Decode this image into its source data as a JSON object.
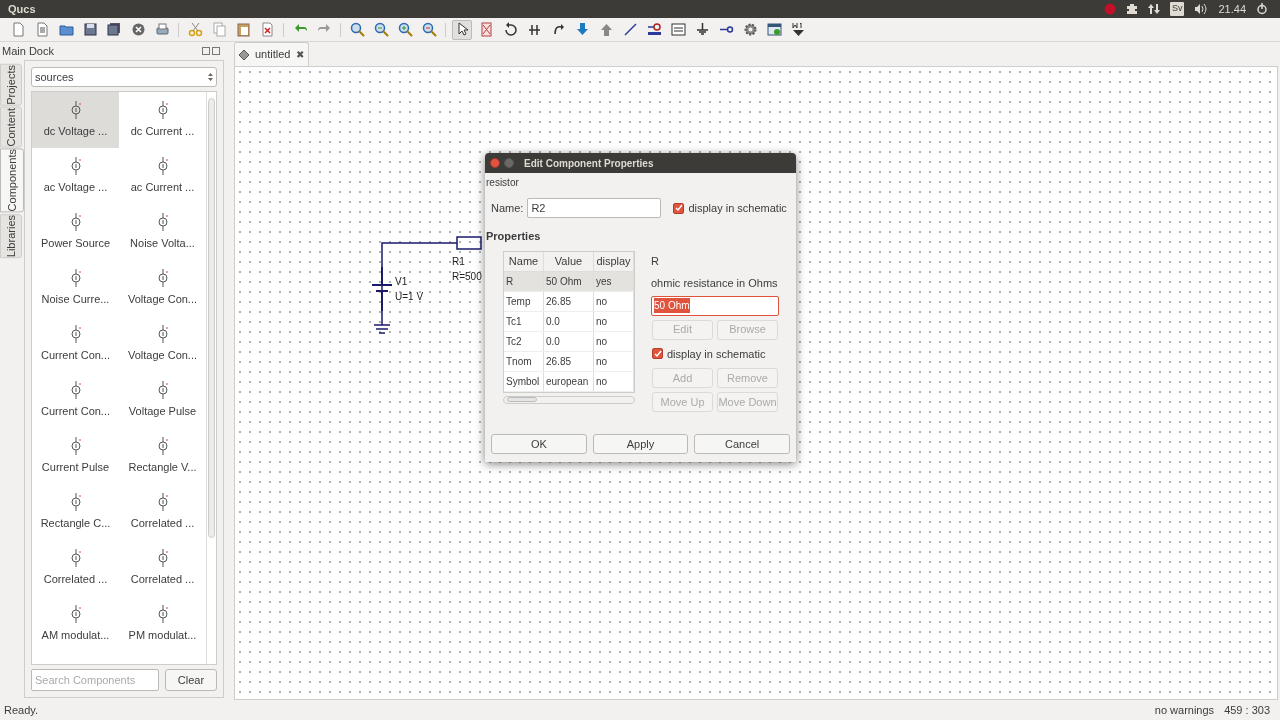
{
  "window": {
    "title": "Qucs"
  },
  "tray": {
    "keyboard_layout": "Sv",
    "time": "21.44"
  },
  "toolbar": {
    "tools": [
      {
        "selected": false
      },
      {
        "selected": false
      },
      {
        "selected": false
      },
      {
        "selected": false
      },
      {
        "selected": false
      },
      {
        "selected": false
      },
      {
        "selected": false
      },
      {
        "selected": false
      },
      {
        "selected": false
      },
      {
        "selected": false
      },
      {
        "selected": false
      },
      {
        "selected": false
      },
      {
        "selected": false
      },
      {
        "selected": false
      },
      {
        "selected": false
      },
      {
        "selected": false
      },
      {
        "selected": false
      },
      {
        "selected": true
      },
      {
        "selected": false
      },
      {
        "selected": false
      },
      {
        "selected": false
      },
      {
        "selected": false
      },
      {
        "selected": false
      },
      {
        "selected": false
      },
      {
        "selected": false
      },
      {
        "selected": false
      },
      {
        "selected": false
      },
      {
        "selected": false
      },
      {
        "selected": false
      },
      {
        "selected": false
      },
      {
        "selected": false
      },
      {
        "selected": false
      }
    ]
  },
  "dock": {
    "title": "Main Dock",
    "tabs": [
      {
        "label": "Projects",
        "selected": false
      },
      {
        "label": "Content",
        "selected": false
      },
      {
        "label": "Components",
        "selected": true
      },
      {
        "label": "Libraries",
        "selected": false
      }
    ],
    "category": "sources",
    "components": [
      {
        "label": "dc Voltage ...",
        "selected": true
      },
      {
        "label": "dc Current ...",
        "selected": false
      },
      {
        "label": "ac Voltage ...",
        "selected": false
      },
      {
        "label": "ac Current ...",
        "selected": false
      },
      {
        "label": "Power Source",
        "selected": false
      },
      {
        "label": "Noise Volta...",
        "selected": false
      },
      {
        "label": "Noise Curre...",
        "selected": false
      },
      {
        "label": "Voltage Con...",
        "selected": false
      },
      {
        "label": "Current Con...",
        "selected": false
      },
      {
        "label": "Voltage Con...",
        "selected": false
      },
      {
        "label": "Current Con...",
        "selected": false
      },
      {
        "label": "Voltage Pulse",
        "selected": false
      },
      {
        "label": "Current Pulse",
        "selected": false
      },
      {
        "label": "Rectangle V...",
        "selected": false
      },
      {
        "label": "Rectangle C...",
        "selected": false
      },
      {
        "label": "Correlated ...",
        "selected": false
      },
      {
        "label": "Correlated ...",
        "selected": false
      },
      {
        "label": "Correlated ...",
        "selected": false
      },
      {
        "label": "AM modulat...",
        "selected": false
      },
      {
        "label": "PM modulat...",
        "selected": false
      }
    ],
    "search": {
      "placeholder": "Search Components"
    },
    "clear_button": "Clear"
  },
  "document_tab": {
    "label": "untitled",
    "close": "✖"
  },
  "schematic": {
    "source_name": "V1",
    "source_value": "U=1 V",
    "resistor_name": "R1",
    "resistor_value": "R=500"
  },
  "dialog": {
    "title": "Edit Component Properties",
    "component_type": "resistor",
    "name_label": "Name:",
    "name_value": "R2",
    "name_display": {
      "label": "display in schematic",
      "checked": true
    },
    "properties_heading": "Properties",
    "columns": [
      "Name",
      "Value",
      "display"
    ],
    "rows": [
      {
        "cells": [
          "R",
          "50 Ohm",
          "yes"
        ],
        "selected": true
      },
      {
        "cells": [
          "Temp",
          "26.85",
          "no"
        ],
        "selected": false
      },
      {
        "cells": [
          "Tc1",
          "0.0",
          "no"
        ],
        "selected": false
      },
      {
        "cells": [
          "Tc2",
          "0.0",
          "no"
        ],
        "selected": false
      },
      {
        "cells": [
          "Tnom",
          "26.85",
          "no"
        ],
        "selected": false
      },
      {
        "cells": [
          "Symbol",
          "european",
          "no"
        ],
        "selected": false
      }
    ],
    "property_name": "R",
    "property_description": "ohmic resistance in Ohms",
    "value_field": {
      "value": "50 Ohm",
      "text_selected": true
    },
    "value_display": {
      "label": "display in schematic",
      "checked": true
    },
    "side_buttons": [
      {
        "label": "Edit",
        "disabled": true
      },
      {
        "label": "Browse",
        "disabled": true
      },
      {
        "label": "Add",
        "disabled": true
      },
      {
        "label": "Remove",
        "disabled": true
      },
      {
        "label": "Move Up",
        "disabled": true
      },
      {
        "label": "Move Down",
        "disabled": true
      }
    ],
    "buttons": [
      "OK",
      "Apply",
      "Cancel"
    ]
  },
  "status_bar": {
    "message": "Ready.",
    "warnings": "no warnings",
    "coordinates": "459 : 303"
  }
}
